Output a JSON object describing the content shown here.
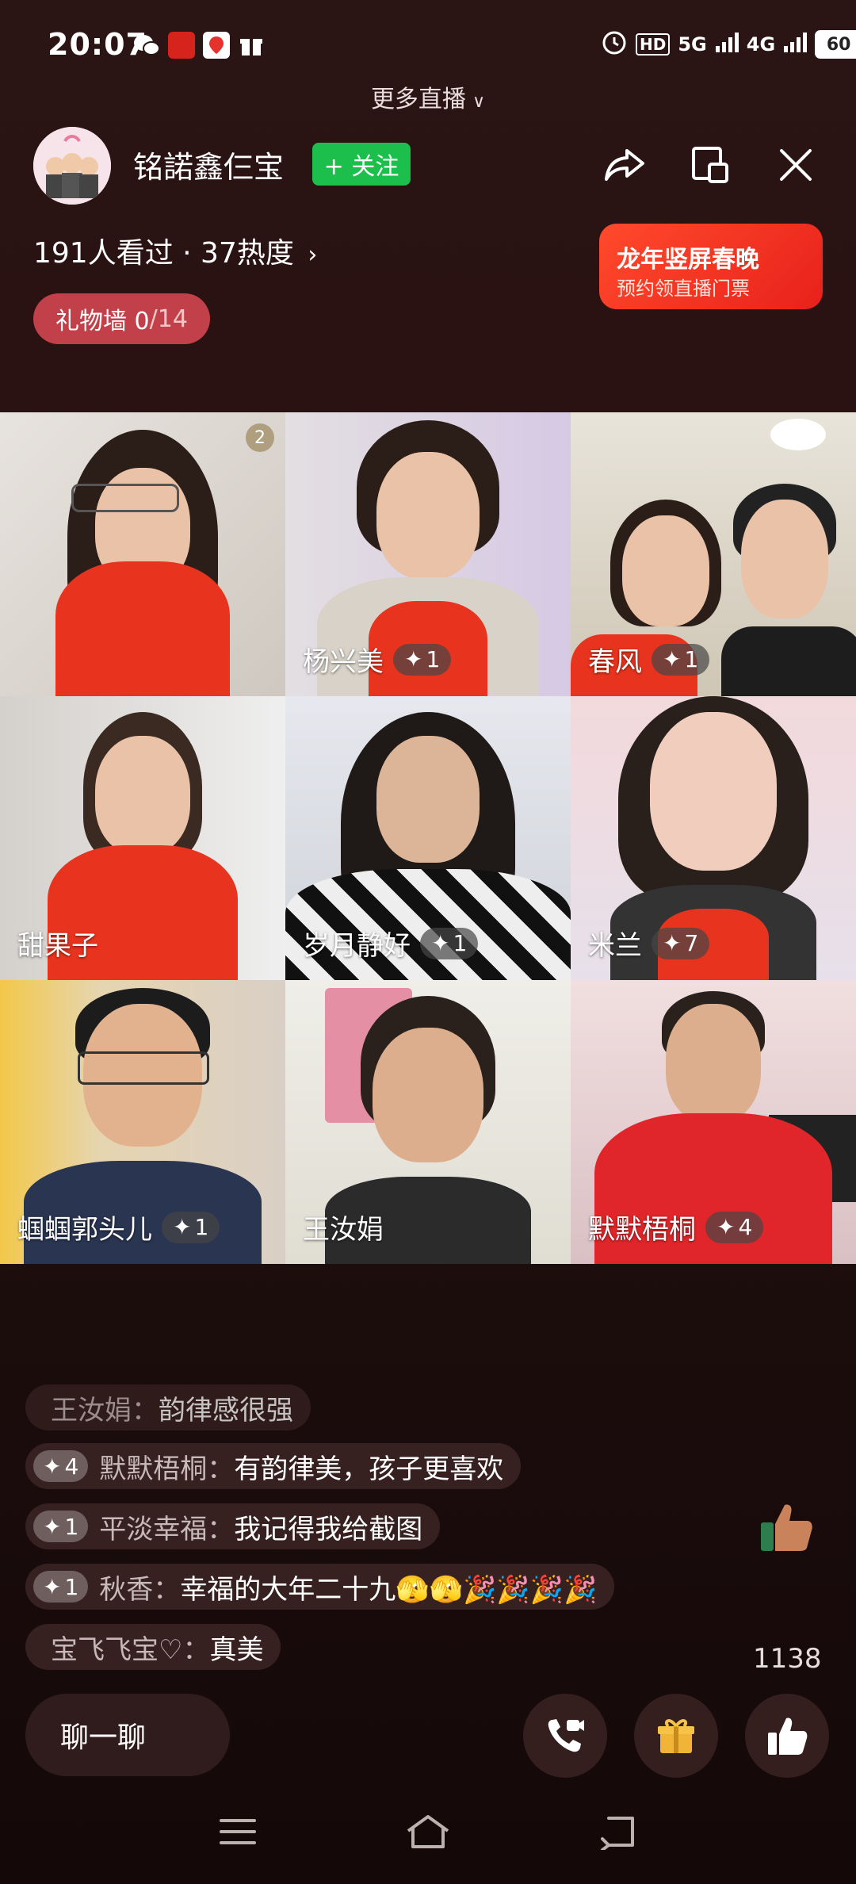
{
  "status_bar": {
    "time": "20:07",
    "network_label": "HD",
    "signal_5g": "5G",
    "signal_4g": "4G",
    "battery": "60"
  },
  "top_link": {
    "label": "更多直播"
  },
  "host": {
    "name": "铭諾鑫仨宝",
    "follow_label": "+ 关注",
    "viewers_text": "191人看过 · 37热度"
  },
  "gift_wall": {
    "label": "礼物墙 0",
    "total": "/14"
  },
  "promo": {
    "title": "龙年竖屏春晚",
    "subtitle": "预约领直播门票"
  },
  "participants": [
    {
      "name": "",
      "level": "",
      "badge": "2"
    },
    {
      "name": "杨兴美",
      "level": "1"
    },
    {
      "name": "春风",
      "level": "1"
    },
    {
      "name": "甜果子",
      "level": ""
    },
    {
      "name": "岁月静好",
      "level": "1"
    },
    {
      "name": "米兰",
      "level": "7"
    },
    {
      "name": "蝈蝈郭头儿",
      "level": "1"
    },
    {
      "name": "王汝娟",
      "level": ""
    },
    {
      "name": "默默梧桐",
      "level": "4"
    }
  ],
  "chat": [
    {
      "level": "",
      "name": "王汝娟：",
      "message": "韵律感很强"
    },
    {
      "level": "4",
      "name": "默默梧桐：",
      "message": "有韵律美，孩子更喜欢"
    },
    {
      "level": "1",
      "name": "平淡幸福：",
      "message": "我记得我给截图"
    },
    {
      "level": "1",
      "name": "秋香：",
      "message": "幸福的大年二十九🫣🫣🎉🎉🎉🎉"
    },
    {
      "level": "",
      "name": "宝飞飞宝♡：",
      "message": "真美"
    }
  ],
  "like_count": "1138",
  "controls": {
    "chat_placeholder": "聊一聊"
  },
  "colors": {
    "follow": "#1dbf4c",
    "gift_wall": "#c2404a",
    "promo": "#e8211b"
  }
}
